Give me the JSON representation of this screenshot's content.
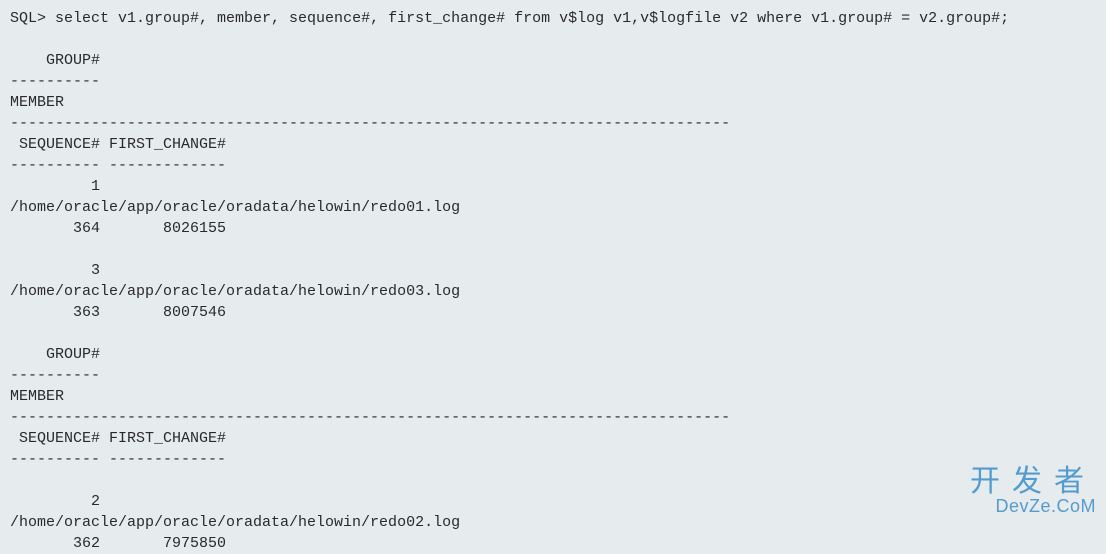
{
  "prompt": "SQL> ",
  "query": "select v1.group#, member, sequence#, first_change# from v$log v1,v$logfile v2 where v1.group# = v2.group#;",
  "header_block": {
    "group_label": "    GROUP#",
    "dash1": "----------",
    "member_label": "MEMBER",
    "dash2": "--------------------------------------------------------------------------------",
    "seq_label": " SEQUENCE# FIRST_CHANGE#",
    "dash3": "---------- -------------"
  },
  "records": [
    {
      "group_line": "         1",
      "member_line": "/home/oracle/app/oracle/oradata/helowin/redo01.log",
      "seq_line": "       364       8026155"
    },
    {
      "group_line": "         3",
      "member_line": "/home/oracle/app/oracle/oradata/helowin/redo03.log",
      "seq_line": "       363       8007546"
    },
    {
      "group_line": "         2",
      "member_line": "/home/oracle/app/oracle/oradata/helowin/redo02.log",
      "seq_line": "       362       7975850"
    }
  ],
  "watermark": {
    "cn": "开发者",
    "en": "DevZe.CoM"
  }
}
